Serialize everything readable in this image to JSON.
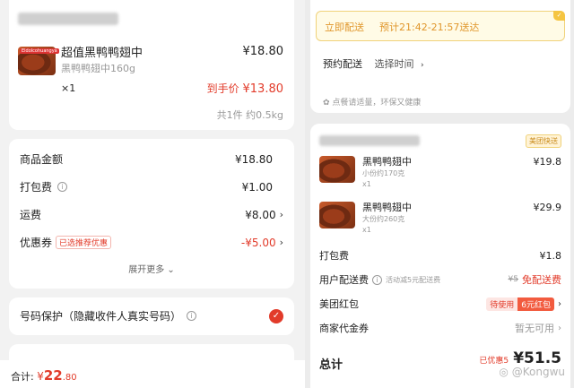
{
  "left": {
    "product": {
      "thumb_tag": "Eldolcohuangya",
      "name": "超值黑鸭鸭翅中",
      "price": "¥18.80",
      "spec": "黑鸭鸭翅中160g",
      "qty": "×1",
      "final_label": "到手价",
      "final_price": "¥13.80",
      "total_summary": "共1件 约0.5kg"
    },
    "fees": {
      "goods_amount_label": "商品金额",
      "goods_amount": "¥18.80",
      "packing_label": "打包费",
      "packing": "¥1.00",
      "shipping_label": "运费",
      "shipping": "¥8.00",
      "coupon_label": "优惠券",
      "coupon_tag": "已选推荐优惠",
      "coupon": "-¥5.00",
      "expand": "展开更多"
    },
    "privacy": {
      "label": "号码保护（隐藏收件人真实号码）"
    },
    "footer": {
      "total_label": "合计:",
      "currency": "¥",
      "total_int": "22",
      "total_dec": ".80"
    }
  },
  "right": {
    "delivery": {
      "mode": "立即配送",
      "eta": "预计21:42-21:57送达",
      "schedule_label": "预约配送",
      "schedule_value": "选择时间",
      "eco_note": "点餐请适量，环保又健康"
    },
    "order": {
      "badge": "美团快送",
      "items": [
        {
          "name": "黑鸭鸭翅中",
          "spec": "小份约170克",
          "qty": "x1",
          "price": "¥19.8"
        },
        {
          "name": "黑鸭鸭翅中",
          "spec": "大份约260克",
          "qty": "x1",
          "price": "¥29.9"
        }
      ],
      "packing_label": "打包费",
      "packing": "¥1.8",
      "user_fee_label": "用户配送费",
      "user_fee_note": "活动减5元配送费",
      "user_fee_old": "¥5",
      "user_fee_new": "免配送费",
      "redpacket_label": "美团红包",
      "redpacket_pending": "待使用",
      "redpacket_value": "6元红包",
      "voucher_label": "商家代金券",
      "voucher_value": "暂无可用",
      "total_label": "总计",
      "total_saved": "已优惠5",
      "total": "¥51.5"
    },
    "watermark": "@Kongwu"
  },
  "colors": {
    "accent_red": "#e23b2a",
    "delivery_yellow": "#fffbe6",
    "delivery_text": "#e0962b",
    "badge_bg": "#fff3d6"
  }
}
